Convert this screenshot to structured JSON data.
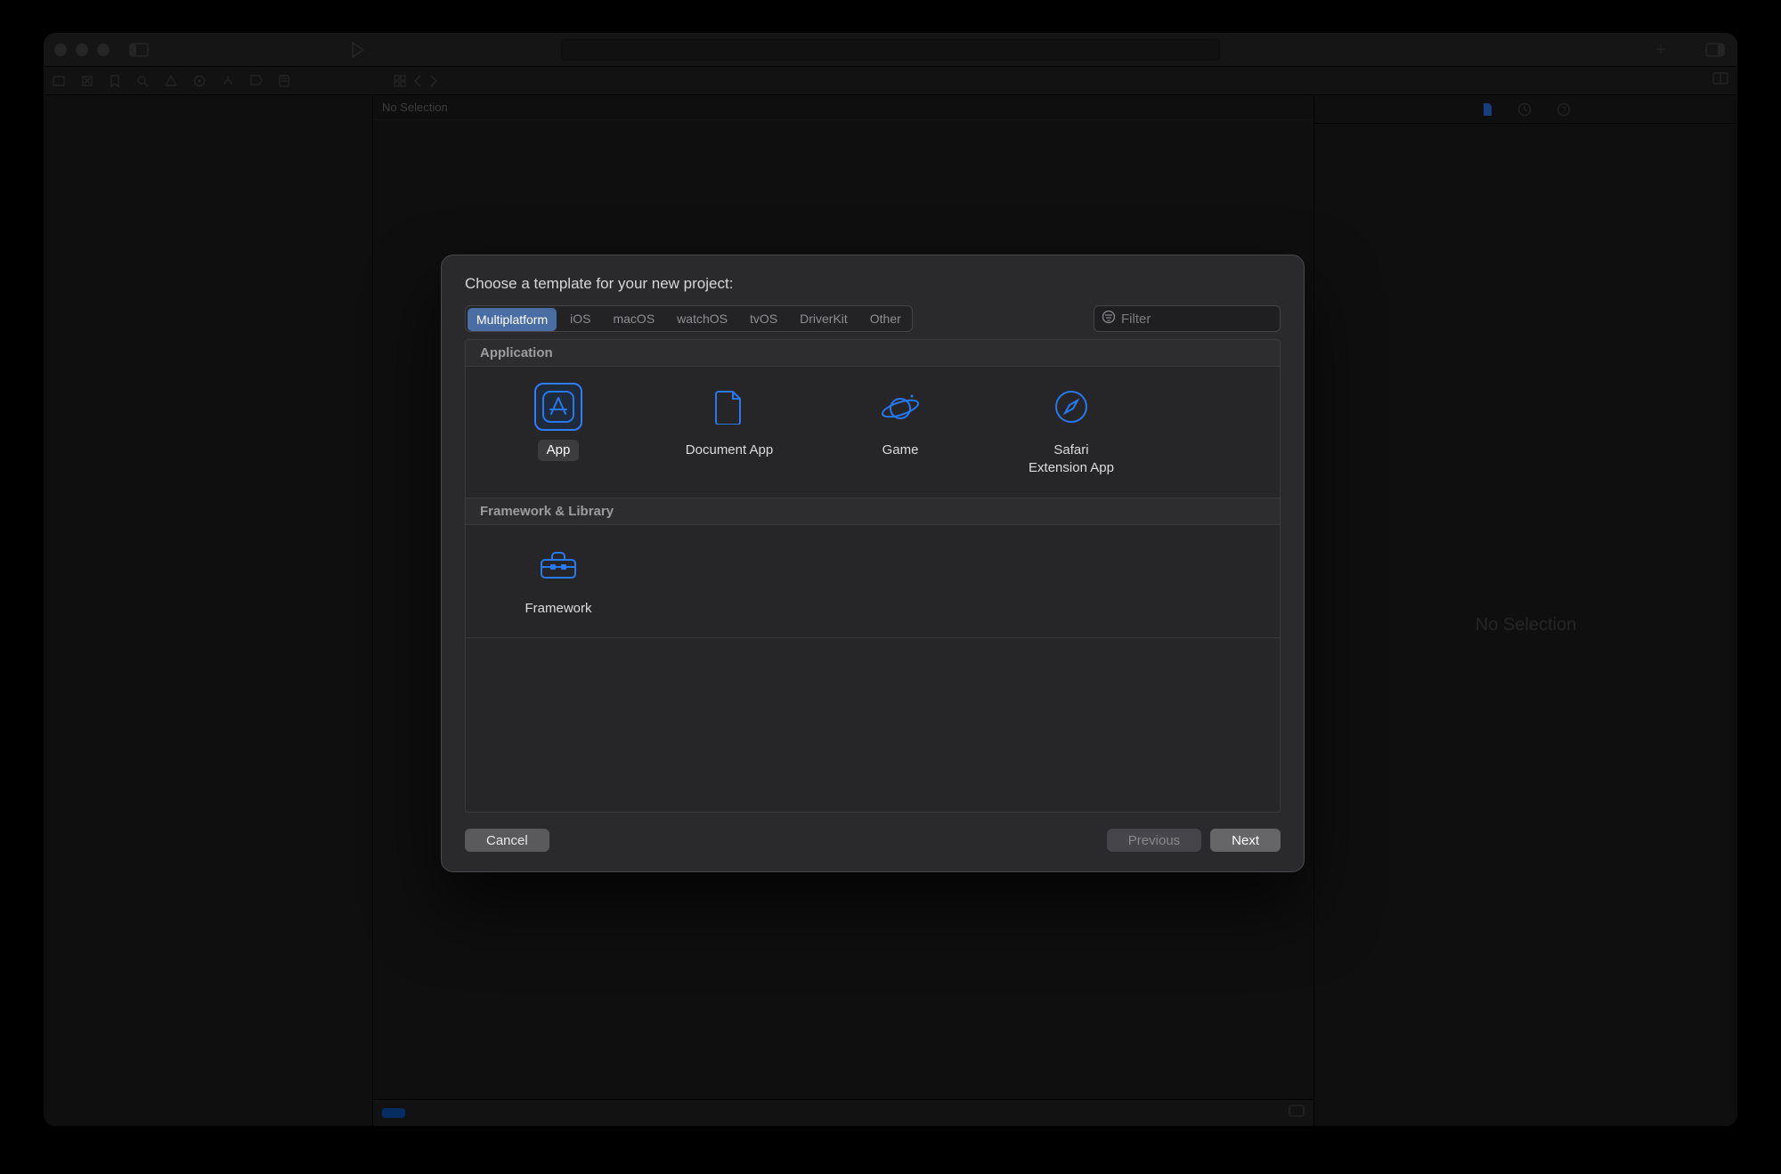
{
  "window": {
    "breadcrumb": "No Selection",
    "inspector_placeholder": "No Selection"
  },
  "modal": {
    "title": "Choose a template for your new project:",
    "platforms": [
      "Multiplatform",
      "iOS",
      "macOS",
      "watchOS",
      "tvOS",
      "DriverKit",
      "Other"
    ],
    "selected_platform": "Multiplatform",
    "filter_placeholder": "Filter",
    "sections": [
      {
        "title": "Application",
        "templates": [
          {
            "name": "App",
            "icon": "app-store-icon",
            "selected": true
          },
          {
            "name": "Document App",
            "icon": "document-icon",
            "selected": false
          },
          {
            "name": "Game",
            "icon": "planet-icon",
            "selected": false
          },
          {
            "name": "Safari Extension App",
            "icon": "compass-icon",
            "selected": false
          }
        ]
      },
      {
        "title": "Framework & Library",
        "templates": [
          {
            "name": "Framework",
            "icon": "toolbox-icon",
            "selected": false
          }
        ]
      }
    ],
    "buttons": {
      "cancel": "Cancel",
      "previous": "Previous",
      "next": "Next"
    }
  }
}
